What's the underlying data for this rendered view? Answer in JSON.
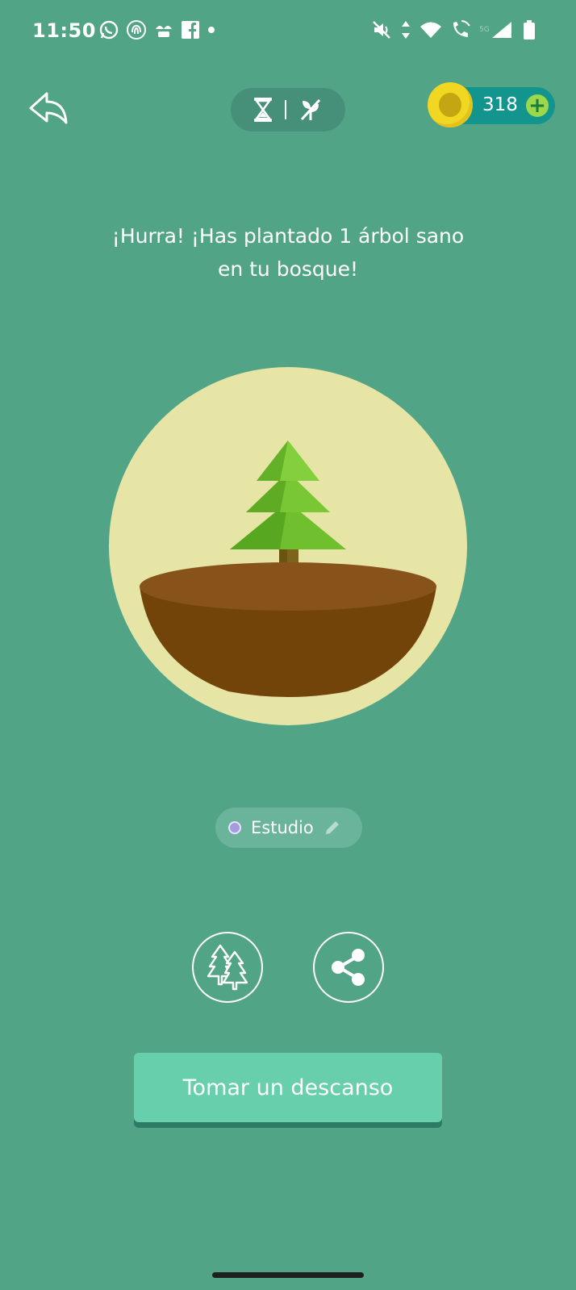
{
  "status_bar": {
    "time": "11:50",
    "left_icons": [
      "whatsapp-icon",
      "fingerprint-icon",
      "plant-icon",
      "facebook-icon",
      "dot-icon"
    ],
    "right_icons": [
      "mute-icon",
      "data-arrows-icon",
      "wifi-icon",
      "wifi-call-icon",
      "signal-icon",
      "battery-icon"
    ]
  },
  "toolbar": {
    "back_icon": "back-arrow-icon",
    "mode_icons": [
      "hourglass-icon",
      "no-sapling-icon"
    ],
    "coins": "318",
    "add_icon": "plus-icon"
  },
  "message": {
    "line1": "¡Hurra! ¡Has plantado 1 árbol sano",
    "line2": "en tu bosque!"
  },
  "tag": {
    "label": "Estudio",
    "dot_color": "#a49be0"
  },
  "actions": {
    "forest_icon": "forest-icon",
    "share_icon": "share-icon"
  },
  "primary_button": {
    "label": "Tomar un descanso"
  },
  "colors": {
    "background": "#52a487",
    "button": "#68cfac",
    "coin_pill": "#13958e",
    "coin": "#f2d722"
  }
}
